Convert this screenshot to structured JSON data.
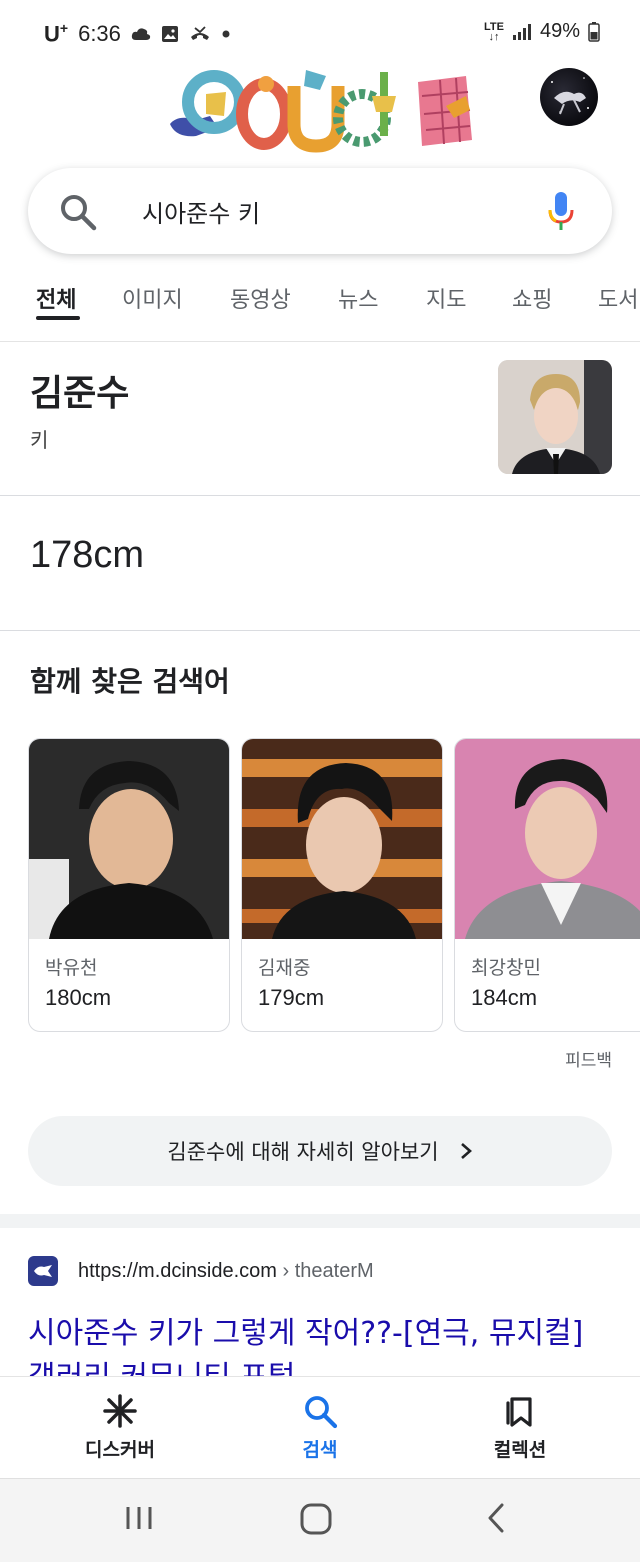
{
  "status_bar": {
    "carrier": "U",
    "carrier_sup": "+",
    "time": "6:36",
    "network": "LTE",
    "battery": "49%"
  },
  "search": {
    "query": "시아준수 키"
  },
  "tabs": [
    {
      "label": "전체",
      "active": true
    },
    {
      "label": "이미지"
    },
    {
      "label": "동영상"
    },
    {
      "label": "뉴스"
    },
    {
      "label": "지도"
    },
    {
      "label": "쇼핑"
    },
    {
      "label": "도서"
    }
  ],
  "knowledge_panel": {
    "title": "김준수",
    "subtitle": "키",
    "answer": "178cm"
  },
  "related": {
    "title": "함께 찾은 검색어",
    "cards": [
      {
        "name": "박유천",
        "value": "180cm"
      },
      {
        "name": "김재중",
        "value": "179cm"
      },
      {
        "name": "최강창민",
        "value": "184cm"
      }
    ],
    "feedback": "피드백"
  },
  "learn_more": {
    "label": "김준수에 대해 자세히 알아보기"
  },
  "result": {
    "url": "https://m.dcinside.com",
    "breadcrumb": "› theaterM",
    "title": "시아준수 키가 그렇게 작어??-[연극, 뮤지컬] 갤러리 커뮤니티 포털"
  },
  "bottom_nav": [
    {
      "label": "디스커버",
      "icon": "asterisk-icon"
    },
    {
      "label": "검색",
      "icon": "search-icon",
      "active": true
    },
    {
      "label": "컬렉션",
      "icon": "collections-icon"
    }
  ],
  "colors": {
    "link": "#1a0dab",
    "accent": "#1a73e8"
  }
}
